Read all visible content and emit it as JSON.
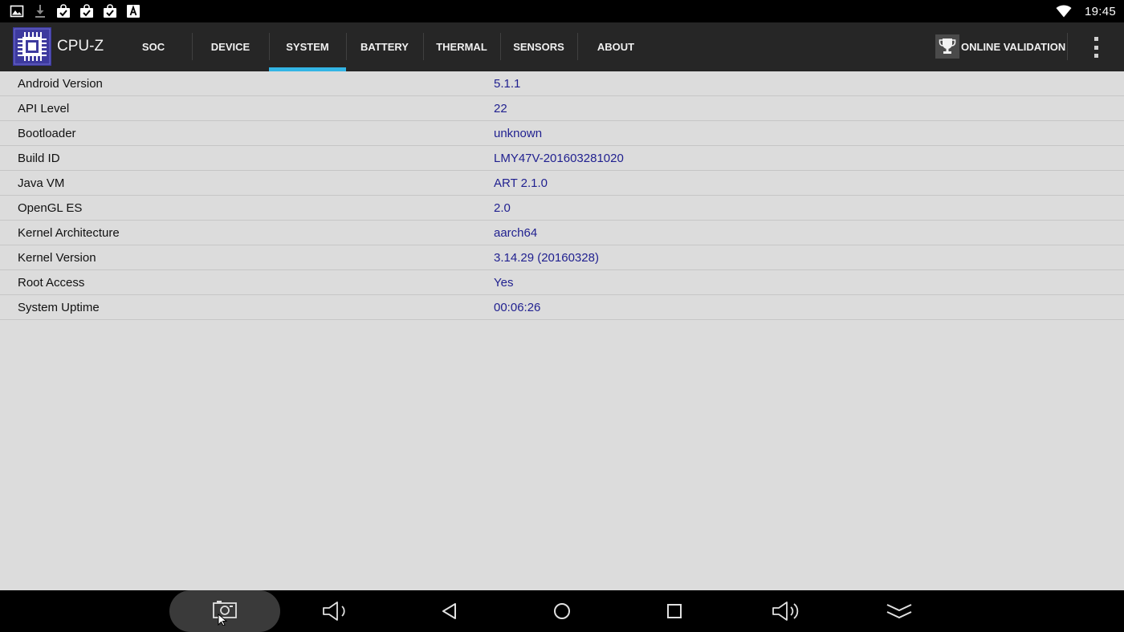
{
  "status_bar": {
    "time": "19:45",
    "left_icons": [
      "image-icon",
      "download-icon",
      "shopping-bag-check-icon",
      "shopping-bag-check-icon",
      "shopping-bag-check-icon",
      "text-a-icon"
    ],
    "right_icons": [
      "wifi-icon"
    ]
  },
  "app_bar": {
    "title": "CPU-Z",
    "logo": "cpu-chip-icon",
    "tabs": [
      {
        "label": "SOC",
        "active": false
      },
      {
        "label": "DEVICE",
        "active": false
      },
      {
        "label": "SYSTEM",
        "active": true
      },
      {
        "label": "BATTERY",
        "active": false
      },
      {
        "label": "THERMAL",
        "active": false
      },
      {
        "label": "SENSORS",
        "active": false
      },
      {
        "label": "ABOUT",
        "active": false
      }
    ],
    "online_validation_label": "ONLINE VALIDATION",
    "overflow_icon": "more-vertical-icon"
  },
  "system_info": {
    "rows": [
      {
        "label": "Android Version",
        "value": "5.1.1"
      },
      {
        "label": "API Level",
        "value": "22"
      },
      {
        "label": "Bootloader",
        "value": "unknown"
      },
      {
        "label": "Build ID",
        "value": "LMY47V-201603281020"
      },
      {
        "label": "Java VM",
        "value": "ART 2.1.0"
      },
      {
        "label": "OpenGL ES",
        "value": "2.0"
      },
      {
        "label": "Kernel Architecture",
        "value": "aarch64"
      },
      {
        "label": "Kernel Version",
        "value": "3.14.29 (20160328)"
      },
      {
        "label": "Root Access",
        "value": "Yes"
      },
      {
        "label": "System Uptime",
        "value": "00:06:26"
      }
    ]
  },
  "nav_bar": {
    "buttons": [
      "screenshot-icon",
      "volume-down-icon",
      "back-icon",
      "home-icon",
      "recents-icon",
      "volume-up-icon",
      "collapse-icon"
    ]
  },
  "colors": {
    "status_bar_bg": "#000000",
    "app_bar_bg": "#262626",
    "tab_indicator": "#33b5e5",
    "content_bg": "#dcdcdc",
    "value_text": "#1f1f8f",
    "logo_bg": "#3d3a9e"
  }
}
